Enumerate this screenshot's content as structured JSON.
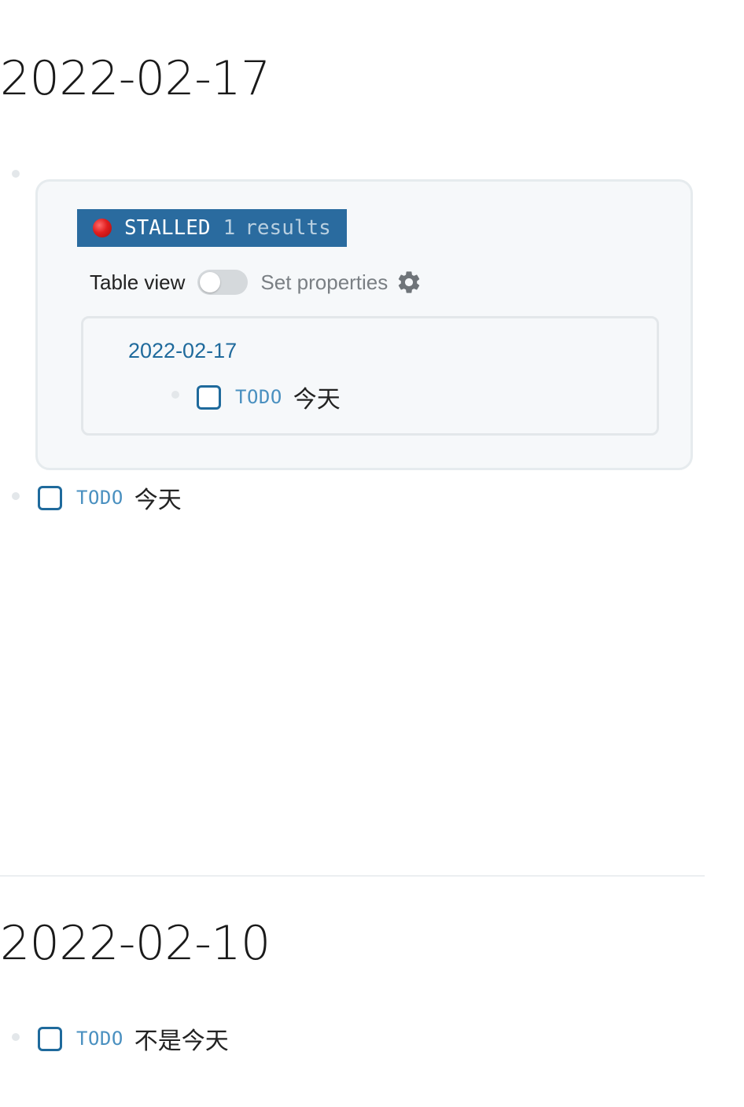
{
  "journals": [
    {
      "title": "2022-02-17",
      "query": {
        "status": "STALLED",
        "count": "1",
        "results_label": "results",
        "table_view_label": "Table view",
        "table_view_on": false,
        "set_properties_label": "Set properties",
        "settings_icon": "gear-icon",
        "result_group": {
          "page": "2022-02-17",
          "item": {
            "marker": "TODO",
            "text": "今天"
          }
        }
      },
      "block": {
        "marker": "TODO",
        "text": "今天"
      }
    },
    {
      "title": "2022-02-10",
      "block": {
        "marker": "TODO",
        "text": "不是今天"
      }
    }
  ],
  "colors": {
    "query_header_bg": "#2a6b9f",
    "stalled_dot": "#e01e1e",
    "link": "#1f6a9c",
    "todo_marker": "#4a90c0",
    "checkbox_border": "#1f6a9c"
  }
}
